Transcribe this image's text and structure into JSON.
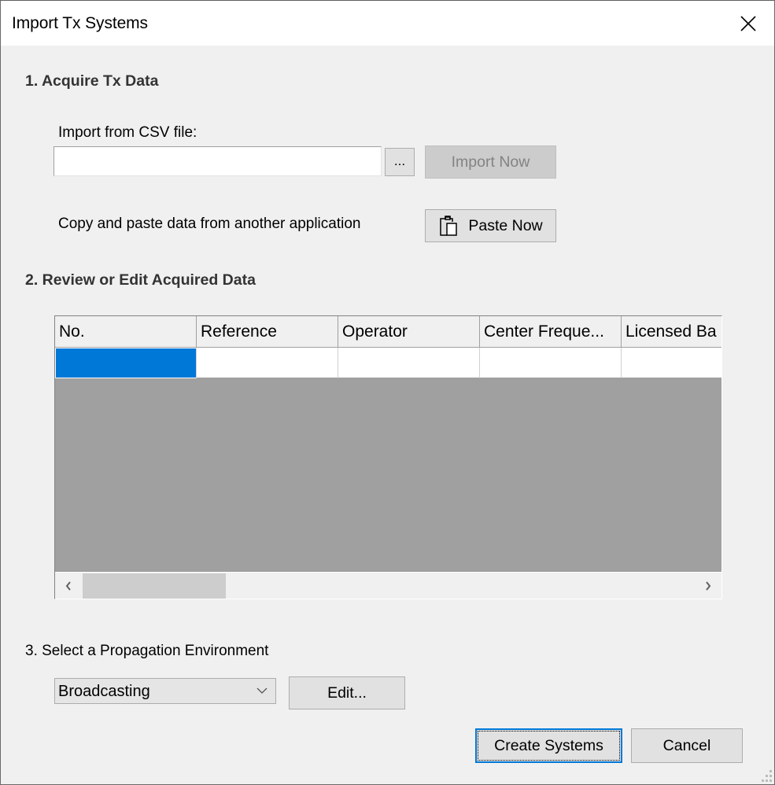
{
  "window": {
    "title": "Import Tx Systems",
    "close_icon": "close-icon"
  },
  "section1": {
    "heading": "1. Acquire Tx Data",
    "csv_label": "Import from CSV file:",
    "csv_path_value": "",
    "browse_label": "...",
    "import_now_label": "Import Now",
    "import_now_enabled": false,
    "paste_label": "Copy and paste data from another application",
    "paste_now_label": "Paste Now",
    "paste_icon": "clipboard-paste-icon"
  },
  "section2": {
    "heading": "2. Review or Edit Acquired Data",
    "columns": [
      {
        "label": "No."
      },
      {
        "label": "Reference"
      },
      {
        "label": "Operator"
      },
      {
        "label": "Center Freque..."
      },
      {
        "label": "Licensed Ba"
      }
    ],
    "rows": [
      [
        "",
        "",
        "",
        "",
        ""
      ]
    ],
    "selected_cell": {
      "row": 0,
      "column": 0
    },
    "selection_color": "#0078d7",
    "scroll_left_icon": "chevron-left-icon",
    "scroll_right_icon": "chevron-right-icon"
  },
  "section3": {
    "heading": "3. Select a Propagation Environment",
    "environment_selected": "Broadcasting",
    "edit_label": "Edit..."
  },
  "footer": {
    "create_label": "Create Systems",
    "cancel_label": "Cancel"
  }
}
